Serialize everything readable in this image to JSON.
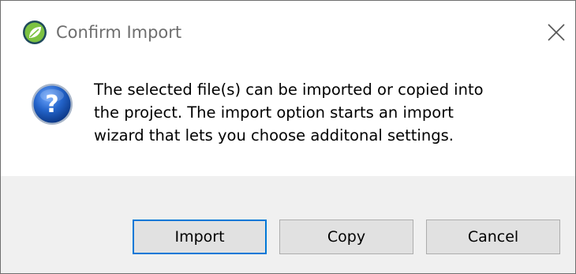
{
  "dialog": {
    "title": "Confirm Import",
    "close_icon": "close-icon",
    "app_icon": "leaf-logo-icon",
    "message_icon": "question-icon",
    "message_lines": [
      "The selected file(s) can be imported or copied into",
      "the project. The import option starts an import",
      "wizard that lets you choose additonal settings."
    ],
    "buttons": {
      "import_label": "Import",
      "copy_label": "Copy",
      "cancel_label": "Cancel"
    },
    "colors": {
      "accent": "#0078d7",
      "footer_bg": "#f0f0f0",
      "button_bg": "#e1e1e1",
      "logo_green": "#7cc242",
      "logo_dark": "#1f4a5c"
    }
  }
}
